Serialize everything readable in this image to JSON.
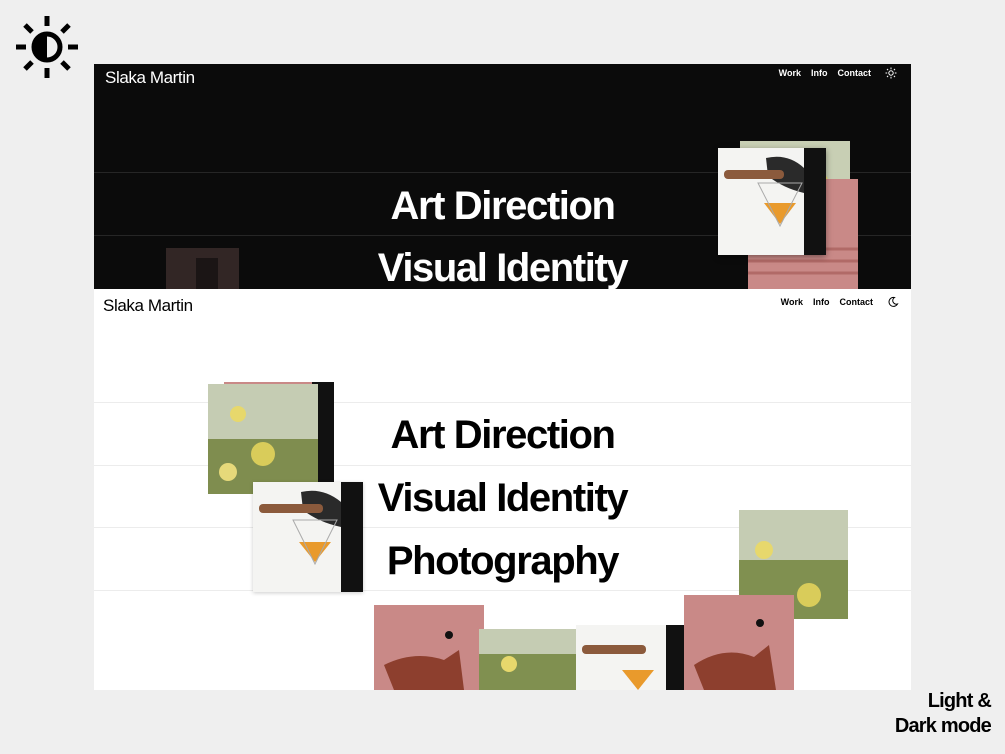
{
  "icons": {
    "contrast": "contrast-sun-icon",
    "light_mode": "sun-icon",
    "dark_mode": "moon-icon"
  },
  "dark_preview": {
    "brand": "Slaka Martin",
    "nav": [
      "Work",
      "Info",
      "Contact"
    ],
    "headings": [
      "Art Direction",
      "Visual Identity"
    ]
  },
  "light_preview": {
    "brand": "Slaka Martin",
    "nav": [
      "Work",
      "Info",
      "Contact"
    ],
    "headings": [
      "Art Direction",
      "Visual Identity",
      "Photography"
    ]
  },
  "caption": {
    "line1": "Light &",
    "line2": "Dark mode"
  },
  "colors": {
    "page_bg": "#efefef",
    "dark_bg": "#0b0b0b",
    "light_bg": "#ffffff"
  }
}
